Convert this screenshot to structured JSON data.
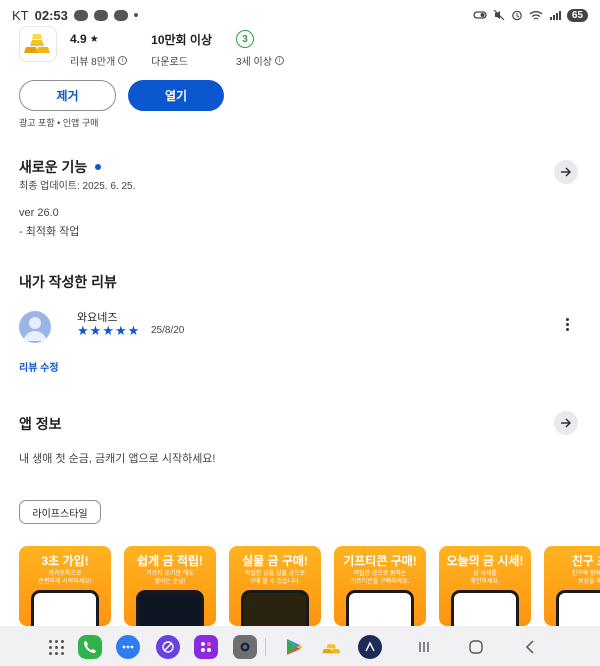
{
  "status_bar": {
    "carrier": "KT",
    "time": "02:53",
    "battery": "65"
  },
  "app": {
    "rating": "4.9",
    "reviews_label": "리뷰 8만개",
    "downloads": "10만회 이상",
    "downloads_label": "다운로드",
    "age_rating": "3",
    "age_label": "3세 이상"
  },
  "actions": {
    "remove_label": "제거",
    "open_label": "열기",
    "notice": "광고 포함 • 인앱 구매"
  },
  "whats_new": {
    "title": "새로운 기능",
    "updated": "최종 업데이트: 2025. 6. 25.",
    "version": "ver 26.0",
    "notes": "- 최적화 작업"
  },
  "my_review": {
    "title": "내가 작성한 리뷰",
    "reviewer": "와요네즈",
    "stars": 5,
    "date": "25/8/20",
    "edit_label": "리뷰 수정"
  },
  "app_info": {
    "title": "앱 정보",
    "description": "내 생애 첫 순금, 금캐기 앱으로 시작하세요!",
    "category_chip": "라이프스타일"
  },
  "screenshots": [
    {
      "title": "3초 가입!",
      "subtitle": "카카오톡으로\n간편하게 시작하세요!"
    },
    {
      "title": "쉽게 금 적립!",
      "subtitle": "기프티 도기만 해도\n쌓이는 순금!"
    },
    {
      "title": "실물 금 구매!",
      "subtitle": "적립한 금을 실물 금으로\n구매 할 수 있습니다."
    },
    {
      "title": "기프티콘 구매!",
      "subtitle": "적립한 금으로 원하는\n기프티콘을 구매하세요."
    },
    {
      "title": "오늘의 금 시세!",
      "subtitle": "금 시세를\n확인하세요."
    },
    {
      "title": "친구 초",
      "subtitle": "친구와 함께 혜\n보상을 제"
    }
  ],
  "colors": {
    "accent": "#0b57d0",
    "card_orange": "#ffa31a",
    "age_green": "#2e9e48"
  }
}
